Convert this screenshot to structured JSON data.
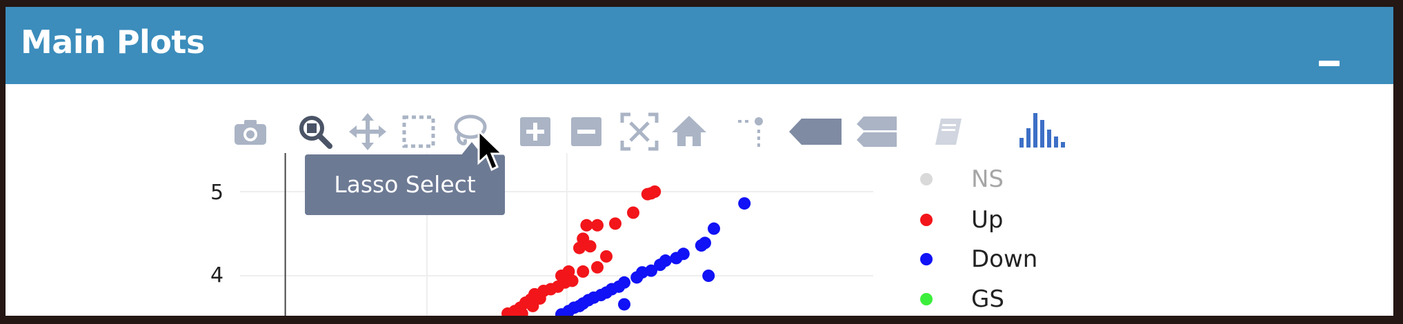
{
  "panel": {
    "title": "Main Plots",
    "collapse_icon": "minus-icon"
  },
  "toolbar": {
    "buttons": [
      {
        "name": "camera-icon",
        "label": "Download plot as a png"
      },
      {
        "name": "zoom-icon",
        "label": "Zoom"
      },
      {
        "name": "pan-icon",
        "label": "Pan"
      },
      {
        "name": "box-select-icon",
        "label": "Box Select"
      },
      {
        "name": "lasso-select-icon",
        "label": "Lasso Select",
        "active": true
      },
      {
        "name": "zoom-in-icon",
        "label": "Zoom in"
      },
      {
        "name": "zoom-out-icon",
        "label": "Zoom out"
      },
      {
        "name": "autoscale-icon",
        "label": "Autoscale"
      },
      {
        "name": "home-icon",
        "label": "Reset axes"
      },
      {
        "name": "spike-lines-icon",
        "label": "Toggle Spike Lines"
      },
      {
        "name": "hover-closest-icon",
        "label": "Show closest data on hover"
      },
      {
        "name": "hover-compare-icon",
        "label": "Compare data on hover"
      },
      {
        "name": "editor-icon",
        "label": "Edit in Chart Studio"
      },
      {
        "name": "plotly-logo-icon",
        "label": "Produced with Plotly"
      }
    ],
    "tooltip": "Lasso Select"
  },
  "colors": {
    "header": "#3c8dbc",
    "ns": "#d9d9d9",
    "up": "#f2151a",
    "down": "#1112f5",
    "gs": "#3cee3c"
  },
  "legend": [
    {
      "label": "NS",
      "color": "#d9d9d9"
    },
    {
      "label": "Up",
      "color": "#f2151a"
    },
    {
      "label": "Down",
      "color": "#1112f5"
    },
    {
      "label": "GS",
      "color": "#3cee3c"
    }
  ],
  "chart_data": {
    "type": "scatter",
    "title": "",
    "xlabel": "",
    "ylabel": "",
    "yticks": [
      "5",
      "4"
    ],
    "series": [
      {
        "name": "NS",
        "x": [],
        "y": []
      },
      {
        "name": "Up",
        "x": [
          1.58,
          1.62,
          1.6,
          1.5,
          1.4,
          1.3,
          1.24,
          1.22,
          1.26,
          1.2,
          1.35,
          1.3,
          1.22,
          1.14,
          1.1,
          1.16,
          1.12,
          1.08,
          1.04,
          1.0,
          0.95,
          0.98,
          0.93,
          0.9,
          0.94,
          0.87,
          0.84,
          0.8,
          0.88,
          0.82
        ],
        "y": [
          4.97,
          5.0,
          4.98,
          4.75,
          4.62,
          4.6,
          4.6,
          4.44,
          4.35,
          4.33,
          4.23,
          4.1,
          4.05,
          4.05,
          4.0,
          3.94,
          3.92,
          3.87,
          3.84,
          3.82,
          3.78,
          3.73,
          3.72,
          3.68,
          3.64,
          3.62,
          3.58,
          3.55,
          3.55,
          3.52
        ]
      },
      {
        "name": "Down",
        "x": [
          2.12,
          1.95,
          1.9,
          1.88,
          1.78,
          1.74,
          1.68,
          1.65,
          1.6,
          1.55,
          1.52,
          1.45,
          1.42,
          1.38,
          1.35,
          1.32,
          1.28,
          1.25,
          1.22,
          1.2,
          1.17,
          1.14,
          1.1,
          1.92,
          1.45
        ],
        "y": [
          4.86,
          4.56,
          4.39,
          4.36,
          4.26,
          4.21,
          4.18,
          4.13,
          4.06,
          4.04,
          3.98,
          3.92,
          3.87,
          3.84,
          3.8,
          3.77,
          3.74,
          3.71,
          3.67,
          3.64,
          3.62,
          3.58,
          3.54,
          4.0,
          3.66
        ]
      },
      {
        "name": "GS",
        "x": [],
        "y": []
      }
    ]
  }
}
